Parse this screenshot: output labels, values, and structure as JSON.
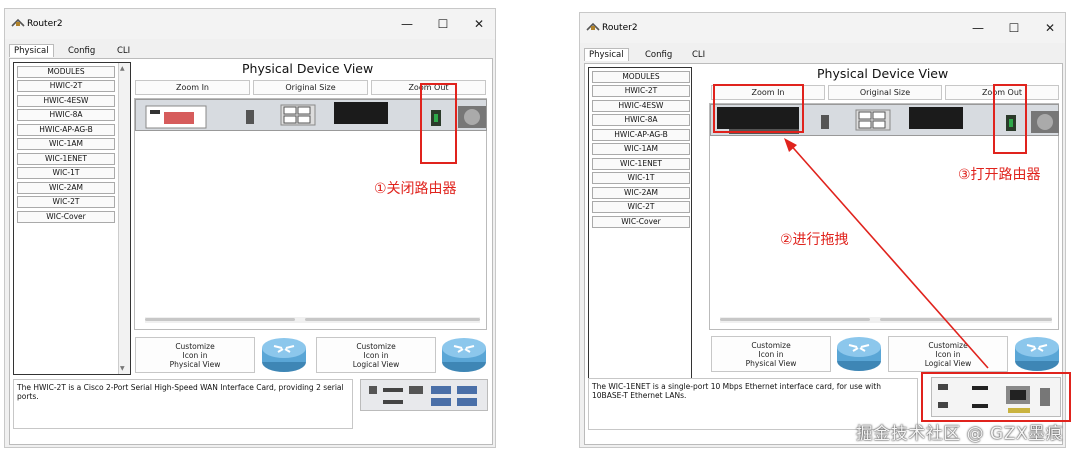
{
  "colors": {
    "annotation": "#e0231d",
    "window_bg": "#f0f0f0"
  },
  "left": {
    "title": "Router2",
    "tabs": [
      "Physical",
      "Config",
      "CLI"
    ],
    "modules": [
      "MODULES",
      "HWIC-2T",
      "HWIC-4ESW",
      "HWIC-8A",
      "HWIC-AP-AG-B",
      "WIC-1AM",
      "WIC-1ENET",
      "WIC-1T",
      "WIC-2AM",
      "WIC-2T",
      "WIC-Cover"
    ],
    "view_title": "Physical Device View",
    "zoom_in": "Zoom In",
    "original_size": "Original Size",
    "zoom_out": "Zoom Out",
    "customize_physical": [
      "Customize",
      "Icon in",
      "Physical View"
    ],
    "customize_logical": [
      "Customize",
      "Icon in",
      "Logical View"
    ],
    "description": "The HWIC-2T is a Cisco 2-Port Serial High-Speed WAN Interface Card, providing 2 serial ports.",
    "annotation": "①关闭路由器"
  },
  "right": {
    "title": "Router2",
    "tabs": [
      "Physical",
      "Config",
      "CLI"
    ],
    "modules": [
      "MODULES",
      "HWIC-2T",
      "HWIC-4ESW",
      "HWIC-8A",
      "HWIC-AP-AG-B",
      "WIC-1AM",
      "WIC-1ENET",
      "WIC-1T",
      "WIC-2AM",
      "WIC-2T",
      "WIC-Cover"
    ],
    "view_title": "Physical Device View",
    "zoom_in": "Zoom In",
    "original_size": "Original Size",
    "zoom_out": "Zoom Out",
    "customize_physical": [
      "Customize",
      "Icon in",
      "Physical View"
    ],
    "customize_logical": [
      "Customize",
      "Icon in",
      "Logical View"
    ],
    "description": "The WIC-1ENET is a single-port 10 Mbps Ethernet interface card, for use with 10BASE-T Ethernet LANs.",
    "annotation_drag": "②进行拖拽",
    "annotation_power": "③打开路由器"
  },
  "watermark": "掘金技术社区 @ GZX墨痕",
  "window_controls": {
    "minimize": "—",
    "maximize": "☐",
    "close": "✕"
  }
}
